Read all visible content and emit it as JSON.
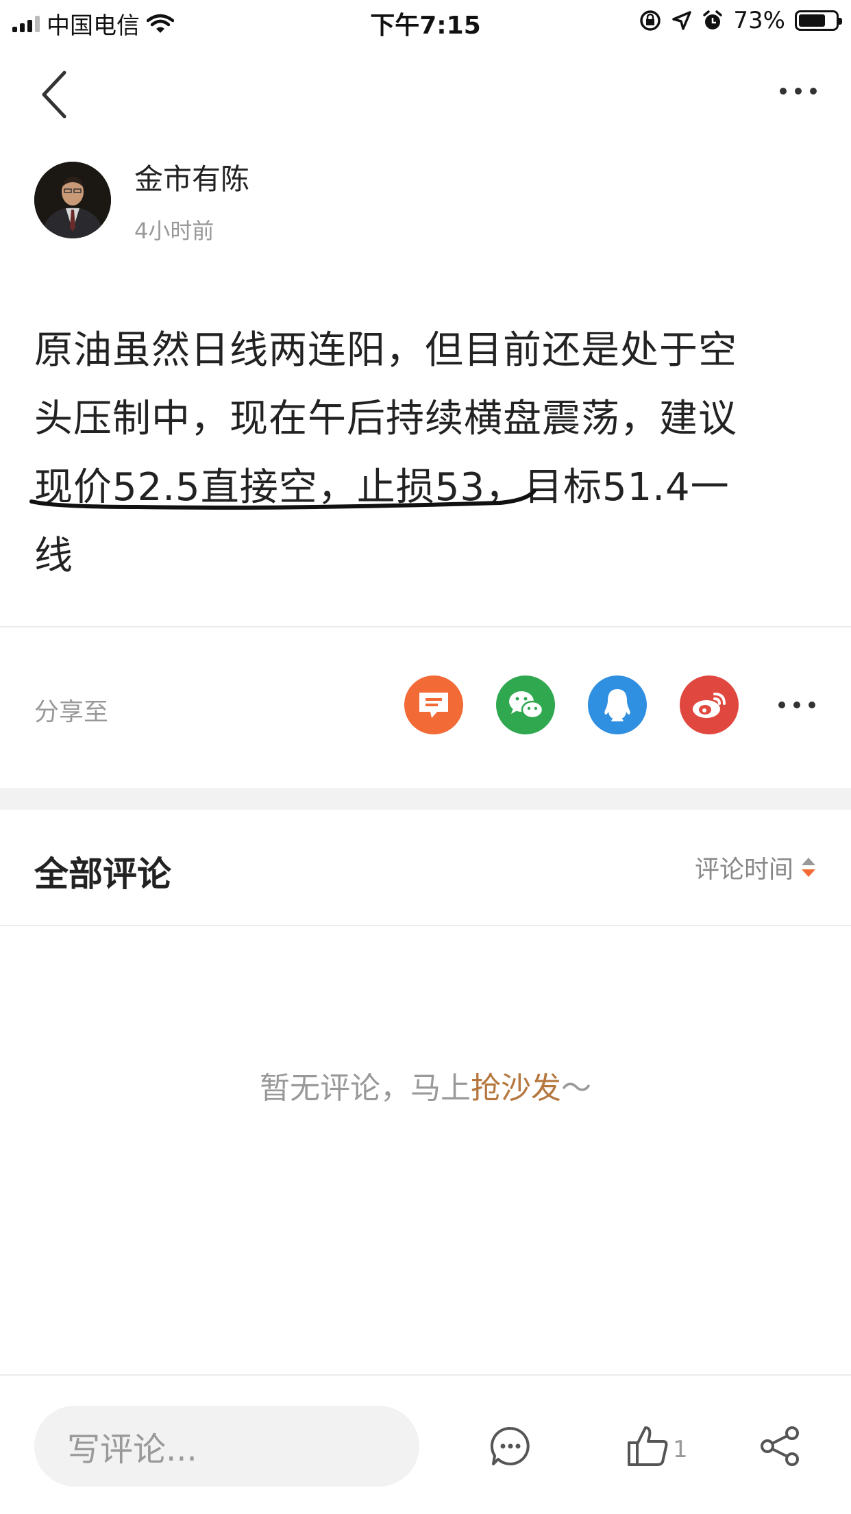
{
  "status_bar": {
    "carrier": "中国电信",
    "time": "下午7:15",
    "battery_percent": "73%",
    "battery_level": 0.73
  },
  "author": {
    "name": "金市有陈",
    "time": "4小时前"
  },
  "post": {
    "line1": "原油虽然日线两连阳，但目前还是处于空",
    "line2": "头压制中，现在午后持续横盘震荡，建议",
    "line3_underlined": "现价52.5直接空，止损53",
    "line3_rest": "，目标51.4一",
    "line4": "线"
  },
  "share": {
    "label": "分享至",
    "targets": [
      {
        "icon": "message-icon",
        "color": "#f26a36"
      },
      {
        "icon": "wechat-icon",
        "color": "#2fa84f"
      },
      {
        "icon": "qq-icon",
        "color": "#2f8fe0"
      },
      {
        "icon": "weibo-icon",
        "color": "#e0473f"
      }
    ]
  },
  "comments": {
    "title": "全部评论",
    "sort_label": "评论时间",
    "empty_prefix": "暂无评论，马上",
    "empty_link": "抢沙发",
    "empty_suffix": "～"
  },
  "bottom_bar": {
    "input_placeholder": "写评论...",
    "like_count": "1"
  },
  "colors": {
    "accent_link": "#b5773e",
    "sort_arrow_up": "#999999",
    "sort_arrow_down": "#f26a36"
  }
}
